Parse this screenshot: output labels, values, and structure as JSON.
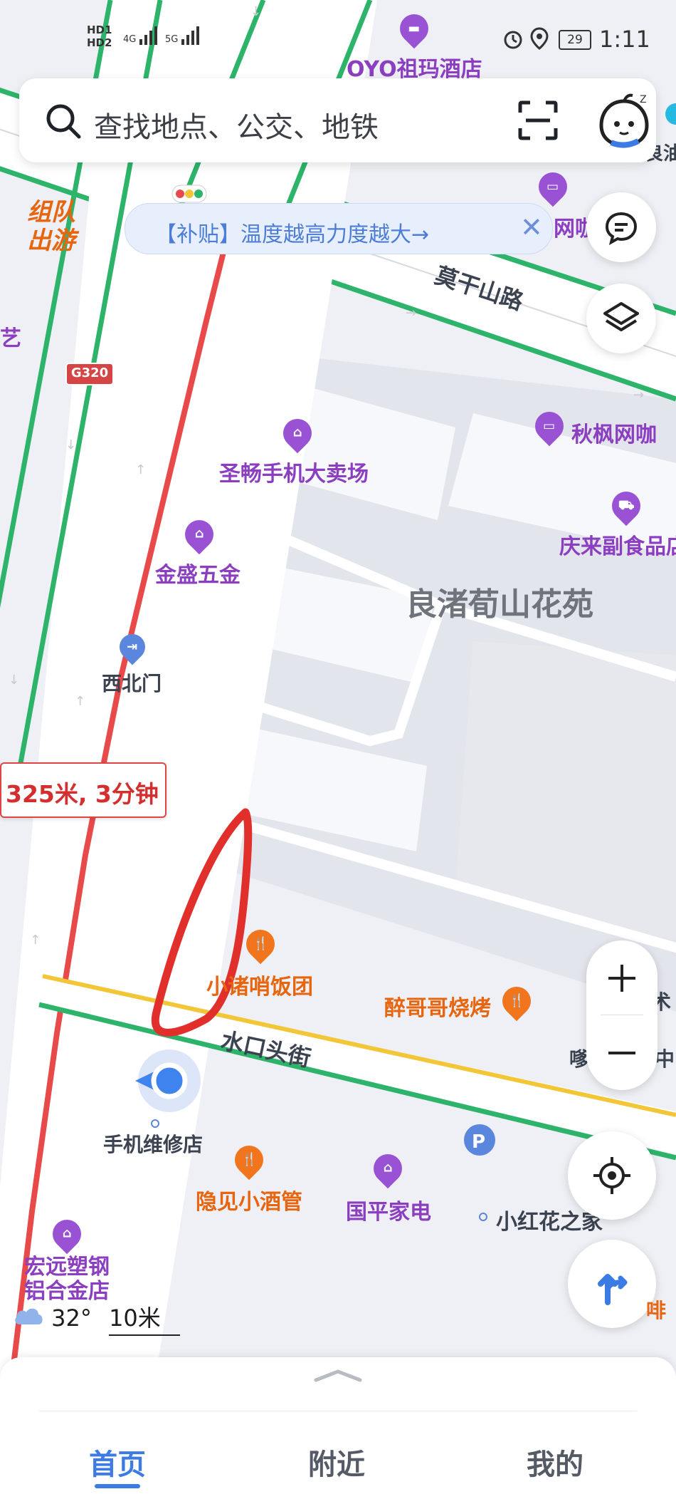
{
  "status_bar": {
    "hd1": "HD1",
    "hd2": "HD2",
    "signal1": "4G",
    "signal2": "5G",
    "battery": "29",
    "time": "1:11"
  },
  "search": {
    "placeholder": "查找地点、公交、地铁"
  },
  "promo": {
    "text": "【补贴】温度越高力度越大→"
  },
  "route": {
    "label": "325米, 3分钟"
  },
  "map_labels": {
    "hotel": "OYO祖玛酒店",
    "group_tour": "组队\n出游",
    "art_fragment": "艺",
    "road_moganshan": "莫干山路",
    "highway": "G320",
    "internet_cafe_top": "网咖",
    "internet_cafe": "秋枫网咖",
    "phone_store": "圣畅手机大卖场",
    "food_store": "庆来副食品店",
    "hardware": "金盛五金",
    "residence": "良渚荀山花苑",
    "northwest_gate": "西北门",
    "restaurant": "小诸哨饭团",
    "bbq": "醉哥哥烧烤",
    "road_shuikou": "水口头街",
    "fragment_right1": "术",
    "fragment_right2": "嗲",
    "fragment_right3": "中",
    "phone_repair": "手机维修店",
    "bar": "隐见小酒管",
    "appliance": "国平家电",
    "flower": "小红花之家",
    "plastic_steel": "宏远塑钢\n铝合金店",
    "fragment_bottom_right": "啡",
    "oil_fragment": "良油"
  },
  "weather": {
    "temperature": "32°",
    "scale": "10米"
  },
  "tabs": [
    {
      "label": "首页"
    },
    {
      "label": "附近"
    },
    {
      "label": "我的"
    }
  ],
  "colors": {
    "accent": "#3d7be4",
    "route_red": "#e84a4a",
    "road_green": "#2db46a",
    "road_yellow": "#f2c636",
    "poi_purple": "#9a52d4",
    "poi_orange": "#f0751d"
  }
}
